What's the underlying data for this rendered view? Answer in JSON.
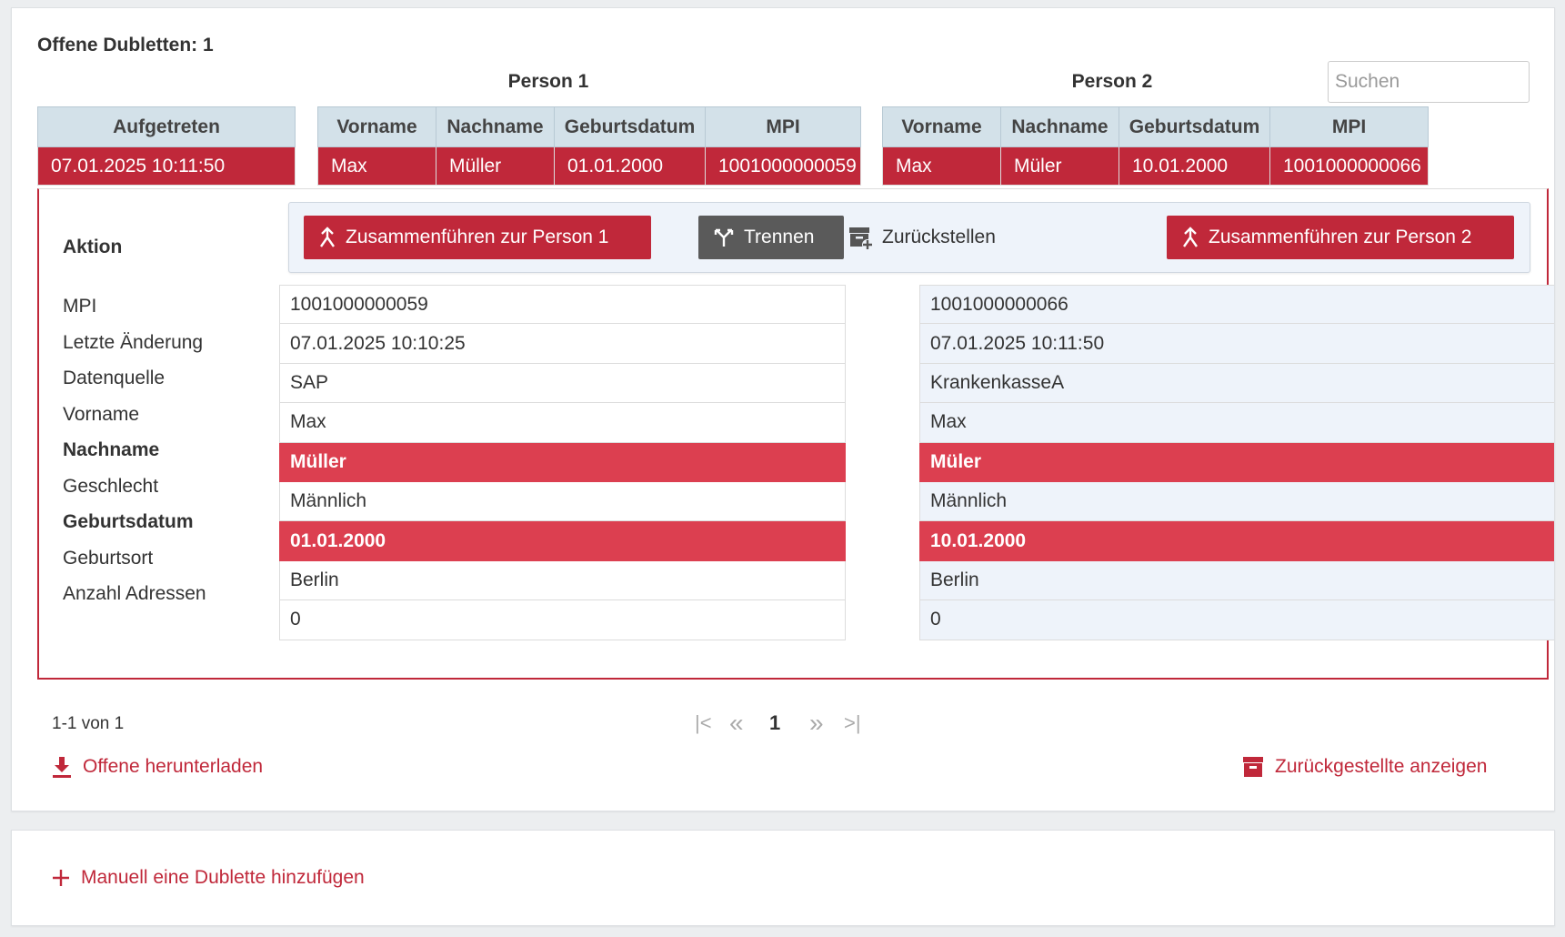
{
  "header": {
    "title": "Offene Dubletten: 1",
    "person1_heading": "Person 1",
    "person2_heading": "Person 2",
    "search_placeholder": "Suchen"
  },
  "grid": {
    "occurred_header": "Aufgetreten",
    "person_columns": [
      "Vorname",
      "Nachname",
      "Geburtsdatum",
      "MPI"
    ],
    "row": {
      "occurred": "07.01.2025 10:11:50",
      "person1": [
        "Max",
        "Müller",
        "01.01.2000",
        "1001000000059"
      ],
      "person2": [
        "Max",
        "Müler",
        "10.01.2000",
        "1001000000066"
      ]
    }
  },
  "detail": {
    "action_label": "Aktion",
    "actions": {
      "merge_p1": "Zusammenführen zur Person 1",
      "split": "Trennen",
      "defer": "Zurückstellen",
      "merge_p2": "Zusammenführen zur Person 2"
    },
    "fields": [
      {
        "label": "MPI",
        "p1": "1001000000059",
        "p2": "1001000000066",
        "diff": false
      },
      {
        "label": "Letzte Änderung",
        "p1": "07.01.2025 10:10:25",
        "p2": "07.01.2025 10:11:50",
        "diff": false
      },
      {
        "label": "Datenquelle",
        "p1": "SAP",
        "p2": "KrankenkasseA",
        "diff": false
      },
      {
        "label": "Vorname",
        "p1": "Max",
        "p2": "Max",
        "diff": false
      },
      {
        "label": "Nachname",
        "p1": "Müller",
        "p2": "Müler",
        "diff": true
      },
      {
        "label": "Geschlecht",
        "p1": "Männlich",
        "p2": "Männlich",
        "diff": false
      },
      {
        "label": "Geburtsdatum",
        "p1": "01.01.2000",
        "p2": "10.01.2000",
        "diff": true
      },
      {
        "label": "Geburtsort",
        "p1": "Berlin",
        "p2": "Berlin",
        "diff": false
      },
      {
        "label": "Anzahl Adressen",
        "p1": "0",
        "p2": "0",
        "diff": false
      }
    ]
  },
  "pagination": {
    "count_text": "1-1 von 1",
    "current_page": "1",
    "first": "|<",
    "prev": "«",
    "next": "»",
    "last": ">|"
  },
  "links": {
    "download": "Offene herunterladen",
    "show_deferred": "Zurückgestellte anzeigen",
    "add_manual": "Manuell eine Dublette hinzufügen"
  },
  "colors": {
    "accent": "#c0283a",
    "diff": "#dc3f50",
    "header_bg": "#d3e1e9",
    "panel_bg": "#eef3fa",
    "split_button": "#5a5a5a"
  },
  "icons": {
    "merge": "merge-icon",
    "split": "split-icon",
    "defer": "archive-add-icon",
    "download": "download-icon",
    "archive": "archive-icon",
    "add": "plus-icon"
  }
}
